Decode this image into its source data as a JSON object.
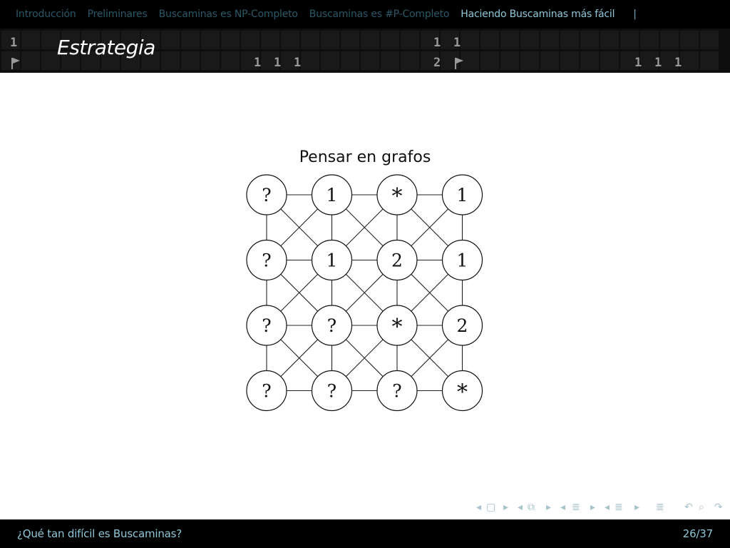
{
  "nav": {
    "sections": [
      {
        "label": "Introducción",
        "active": false
      },
      {
        "label": "Preliminares",
        "active": false
      },
      {
        "label": "Buscaminas es NP-Completo",
        "active": false
      },
      {
        "label": "Buscaminas es #P-Completo",
        "active": false
      },
      {
        "label": "Haciendo Buscaminas más fácil",
        "active": true
      }
    ],
    "separator": "|"
  },
  "title_bar": {
    "title": "Estrategia",
    "digits": [
      "1",
      "1",
      "1",
      "1",
      "1",
      "1",
      "2",
      "1",
      "1",
      "1"
    ]
  },
  "block": {
    "title": "Pensar en grafos"
  },
  "graph": {
    "rows": [
      [
        "?",
        "1",
        "*",
        "1"
      ],
      [
        "?",
        "1",
        "2",
        "1"
      ],
      [
        "?",
        "?",
        "*",
        "2"
      ],
      [
        "?",
        "?",
        "?",
        "*"
      ]
    ]
  },
  "beamer_nav": {
    "icons": [
      "frame-prev-arrow-icon",
      "frame-icon",
      "frame-next-arrow-icon",
      "subsection-prev-arrow-icon",
      "subsection-icon",
      "subsection-next-arrow-icon",
      "section-prev-arrow-icon",
      "section-icon",
      "section-next-arrow-icon",
      "subsubsection-prev-arrow-icon",
      "subsubsection-icon",
      "subsubsection-next-arrow-icon",
      "outline-icon",
      "back-icon",
      "search-icon",
      "forward-icon"
    ]
  },
  "footer": {
    "short_title": "¿Qué tan difícil es Buscaminas?",
    "page_number": "26/37"
  },
  "colors": {
    "nav_inactive": "#2b5766",
    "nav_active": "#8fc7d8",
    "footer_text": "#8fc7d8",
    "bar_background": "#000000"
  }
}
